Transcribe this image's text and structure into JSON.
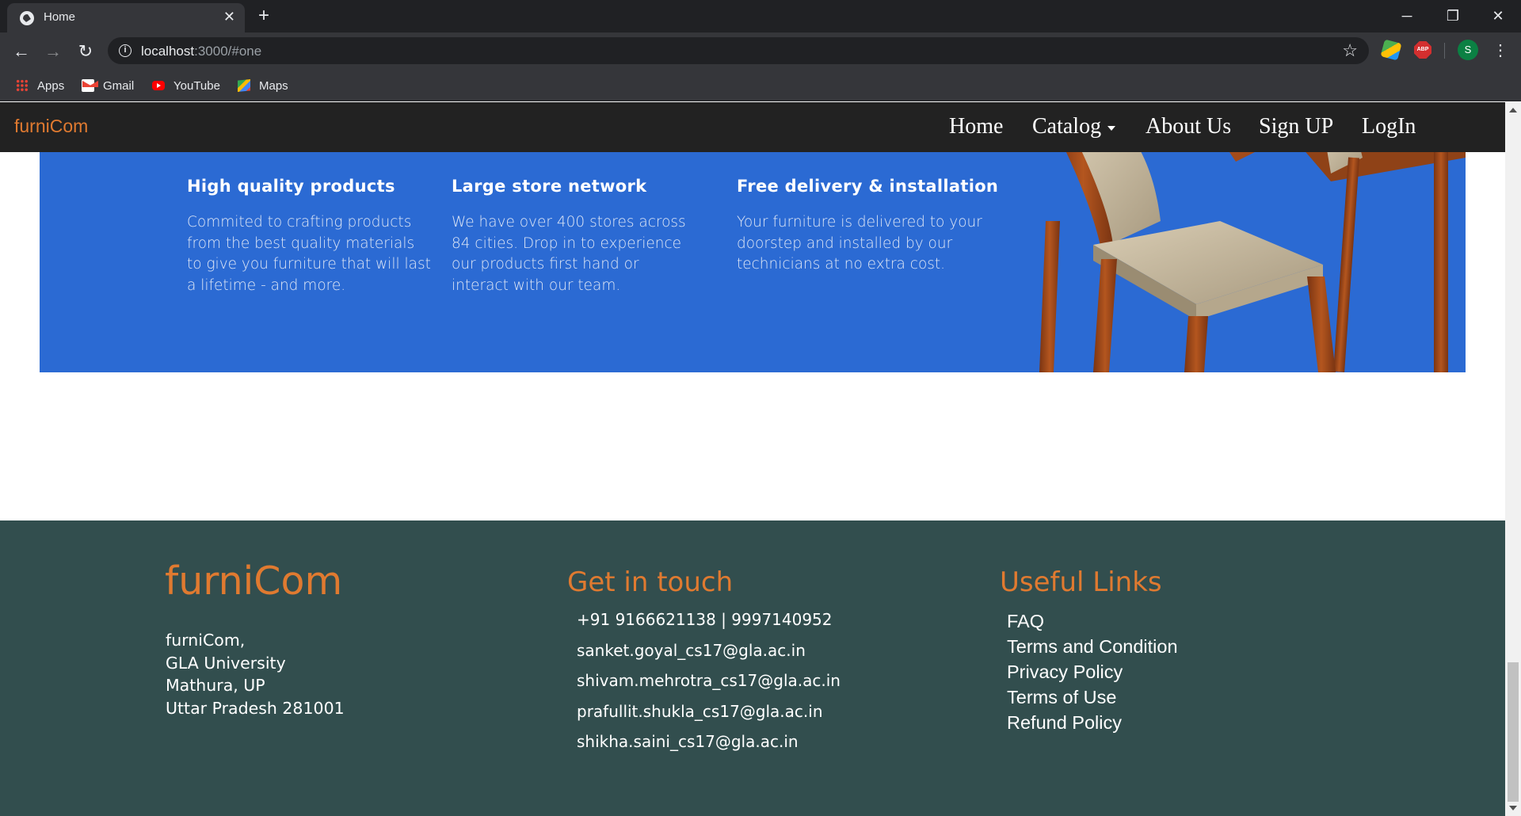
{
  "browser": {
    "tab_title": "Home",
    "tab_close": "✕",
    "new_tab": "+",
    "url_host": "localhost",
    "url_rest": ":3000/#one",
    "window_controls": [
      "─",
      "❐",
      "✕"
    ],
    "extensions": {
      "abp_label": "ABP",
      "avatar_initial": "S"
    },
    "bookmarks": [
      "Apps",
      "Gmail",
      "YouTube",
      "Maps"
    ]
  },
  "nav": {
    "brand": "furniCom",
    "links": [
      "Home",
      "Catalog",
      "About Us",
      "Sign UP",
      "LogIn"
    ]
  },
  "features": [
    {
      "icon": "sofa-badge-icon",
      "title": "High quality products",
      "desc": "Commited to crafting products from the best quality materials to give you furniture that will last a lifetime - and more."
    },
    {
      "icon": "map-pin-network-icon",
      "title": "Large store network",
      "desc": "We have over 400 stores across 84 cities. Drop in to experience our products first hand or interact with our team."
    },
    {
      "icon": "delivery-truck-icon",
      "title": "Free delivery & installation",
      "desc": "Your furniture is delivered to your doorstep and installed by our technicians at no extra cost."
    }
  ],
  "colors": {
    "banner": "#2b6ad3",
    "footer": "#324e4e",
    "accent": "#e07a30",
    "navbar": "#222222"
  },
  "footer": {
    "brand": "furniCom",
    "address": [
      "furniCom,",
      "GLA University",
      "Mathura, UP",
      "Uttar Pradesh 281001"
    ],
    "contact_title": "Get in touch",
    "contacts": [
      "+91 9166621138 | 9997140952",
      "sanket.goyal_cs17@gla.ac.in",
      "shivam.mehrotra_cs17@gla.ac.in",
      "prafullit.shukla_cs17@gla.ac.in",
      "shikha.saini_cs17@gla.ac.in"
    ],
    "links_title": "Useful Links",
    "links": [
      "FAQ",
      "Terms and Condition",
      "Privacy Policy",
      "Terms of Use",
      "Refund Policy"
    ]
  }
}
